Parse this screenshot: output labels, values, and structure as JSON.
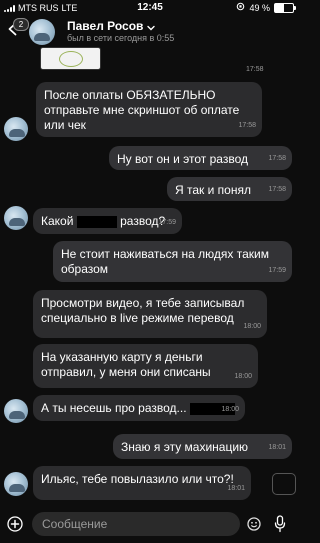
{
  "status_bar": {
    "carrier": "MTS RUS",
    "network": "LTE",
    "time": "12:45",
    "battery": "49 %",
    "battery_level_percent": 49
  },
  "header": {
    "unread_badge": "2",
    "contact_name": "Павел Росов",
    "last_seen": "был в сети сегодня в 0:55"
  },
  "messages": [
    {
      "dir": "in",
      "time": "17:58",
      "kind": "image"
    },
    {
      "dir": "in",
      "text": "После оплаты ОБЯЗАТЕЛЬНО отправьте мне скриншот об оплате или чек",
      "time": "17:58"
    },
    {
      "dir": "out",
      "text": "Ну вот он и этот развод",
      "time": "17:58"
    },
    {
      "dir": "out",
      "text": "Я так и понял",
      "time": "17:58"
    },
    {
      "dir": "in",
      "text_before": "Какой",
      "text_after": "развод?",
      "time": "17:59"
    },
    {
      "dir": "out",
      "text": "Не стоит наживаться на людях таким образом",
      "time": "17:59"
    },
    {
      "dir": "in",
      "text": "Просмотри видео, я тебе записывал специально в live режиме перевод",
      "time": "18:00"
    },
    {
      "dir": "in",
      "text": "На указанную карту я деньги отправил, у меня они списаны",
      "time": "18:00"
    },
    {
      "dir": "in",
      "text": "А ты несешь про развод...",
      "time": "18:00"
    },
    {
      "dir": "out",
      "text": "Знаю я эту махинацию",
      "time": "18:01"
    },
    {
      "dir": "in",
      "text": "Ильяс, тебе повылазило или что?!",
      "time": "18:01"
    }
  ],
  "composer": {
    "placeholder": "Сообщение"
  },
  "colors": {
    "background": "#0d0d0d",
    "bubble_in": "#2c2c2e",
    "bubble_out": "#333336",
    "secondary_text": "#9a9a9a"
  },
  "icons": [
    "back-arrow-icon",
    "chevron-down-icon",
    "attach-plus-icon",
    "emoji-icon",
    "microphone-icon",
    "gif-icon"
  ]
}
